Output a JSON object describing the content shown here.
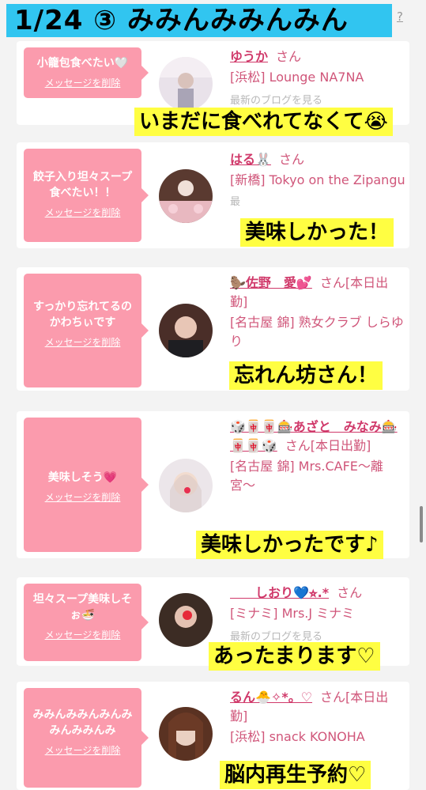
{
  "header": {
    "banner": "1/24 ③ みみんみみんみん",
    "help": "?"
  },
  "delete_label": "メッセージを削除",
  "cards": [
    {
      "message": "小籠包食べたい🤍",
      "name": "ゆうか",
      "san": "さん",
      "venue": "[浜松] Lounge NA7NA",
      "blog": "最新のブログを見る",
      "caption": "いまだに食べれてなくて😭"
    },
    {
      "message": "餃子入り坦々スープ食べたい！！",
      "name": "はる🐰",
      "san": "さん",
      "venue": "[新橋] Tokyo on the Zipangu",
      "blog": "最",
      "caption": "美味しかった！"
    },
    {
      "message": "すっかり忘れてるのかわちぃです",
      "name": "🦫佐野　愛💕",
      "san": "さん[本日出勤]",
      "venue": "[名古屋 錦] 熟女クラブ しらゆり",
      "caption": "忘れん坊さん！"
    },
    {
      "message": "美味しそう💗",
      "name": "🎲🀄🀄🎰あざと　みなみ🎰🀄🀄🎲",
      "san": "さん[本日出勤]",
      "venue": "[名古屋 錦] Mrs.CAFE〜離宮〜",
      "caption": "美味しかったです♪"
    },
    {
      "message": "坦々スープ美味しそぉ🍜",
      "name": "　　しおり💙⭐︎.*",
      "san": "さん",
      "venue": "[ミナミ] Mrs.J ミナミ",
      "blog": "最新のブログを見る",
      "caption": "あったまります♡"
    },
    {
      "message": "みみんみみんみんみみんみみんみ",
      "name": "るん🐣✧*。♡",
      "san": "さん[本日出勤]",
      "venue": "[浜松] snack KONOHA",
      "caption": "脳内再生予約♡"
    }
  ],
  "colors": {
    "banner": "#31c5f0",
    "bubble": "#fb9bad",
    "caption": "#fffe42",
    "name": "#d0396a"
  }
}
